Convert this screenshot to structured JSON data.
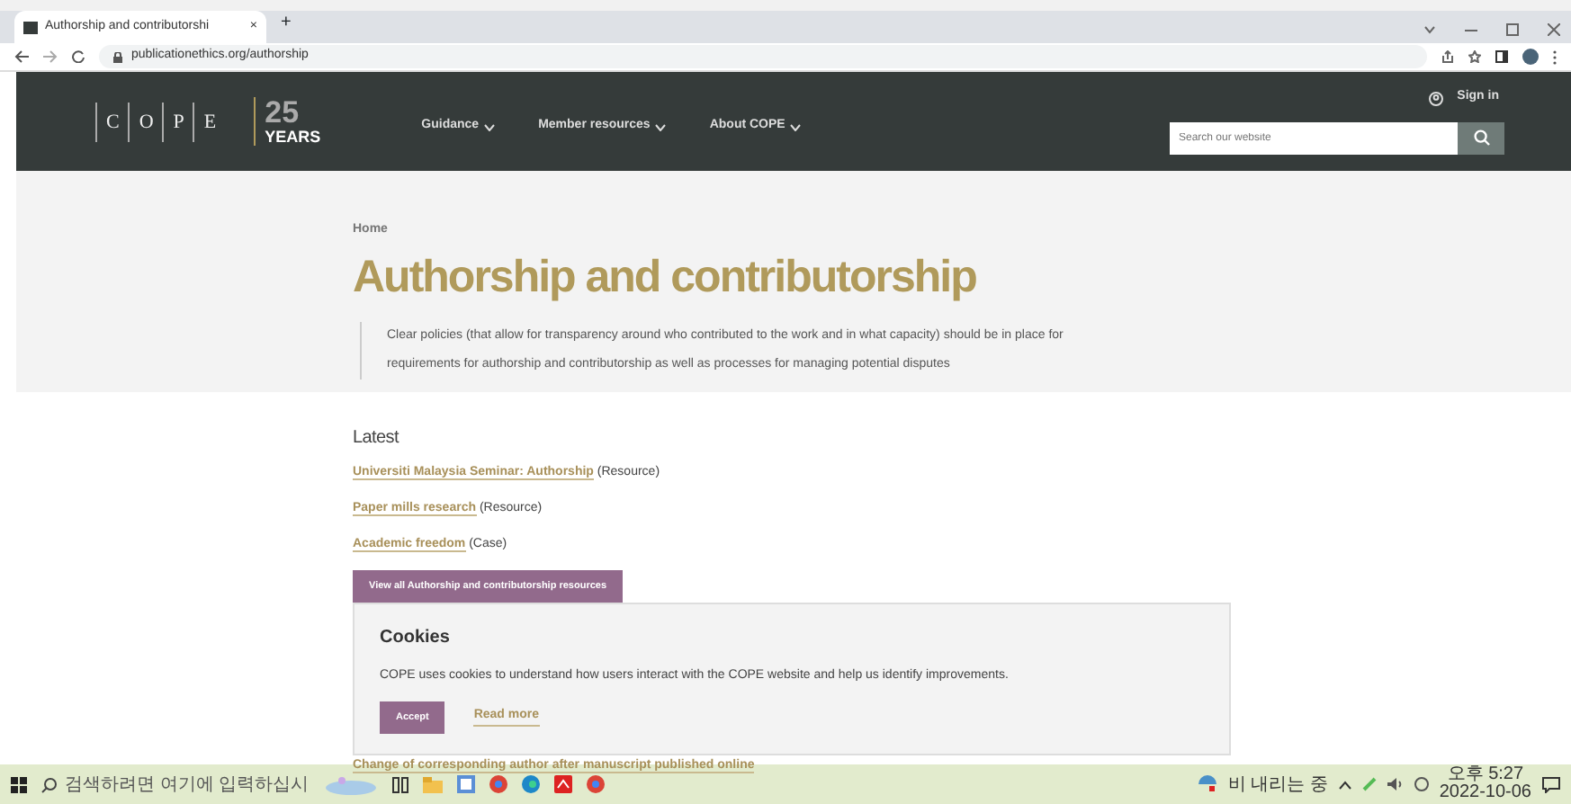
{
  "browser": {
    "tab": {
      "title": "Authorship and contributorshi",
      "close": "×"
    },
    "new_tab": "+",
    "url": "publicationethics.org/authorship"
  },
  "header": {
    "logo": {
      "letters": [
        "C",
        "O",
        "P",
        "E"
      ],
      "number": "25",
      "caption": "YEARS"
    },
    "nav": [
      {
        "label": "Guidance"
      },
      {
        "label": "Member resources"
      },
      {
        "label": "About COPE"
      }
    ],
    "sign_in": "Sign in",
    "search": {
      "placeholder": "Search our website"
    }
  },
  "hero": {
    "breadcrumb": "Home",
    "title": "Authorship and contributorship",
    "summary": "Clear policies (that allow for transparency around who contributed to the work and in what capacity) should be in place for requirements for authorship and contributorship as well as processes for managing potential disputes"
  },
  "latest": {
    "heading": "Latest",
    "items": [
      {
        "title": "Universiti Malaysia Seminar: Authorship",
        "type": "(Resource)"
      },
      {
        "title": "Paper mills research",
        "type": "(Resource)"
      },
      {
        "title": "Academic freedom",
        "type": "(Case)"
      }
    ],
    "view_all": "View all Authorship and contributorship resources"
  },
  "more_links": [
    "Change of corresponding author after manuscript published online"
  ],
  "cookie_banner": {
    "title": "Cookies",
    "text": "COPE uses cookies to understand how users interact with the COPE website and help us identify improvements.",
    "accept": "Accept",
    "read_more": "Read more"
  },
  "taskbar": {
    "search_placeholder": "검색하려면 여기에 입력하십시",
    "weather": "비 내리는 중",
    "time": "오후 5:27",
    "date": "2022-10-06"
  }
}
